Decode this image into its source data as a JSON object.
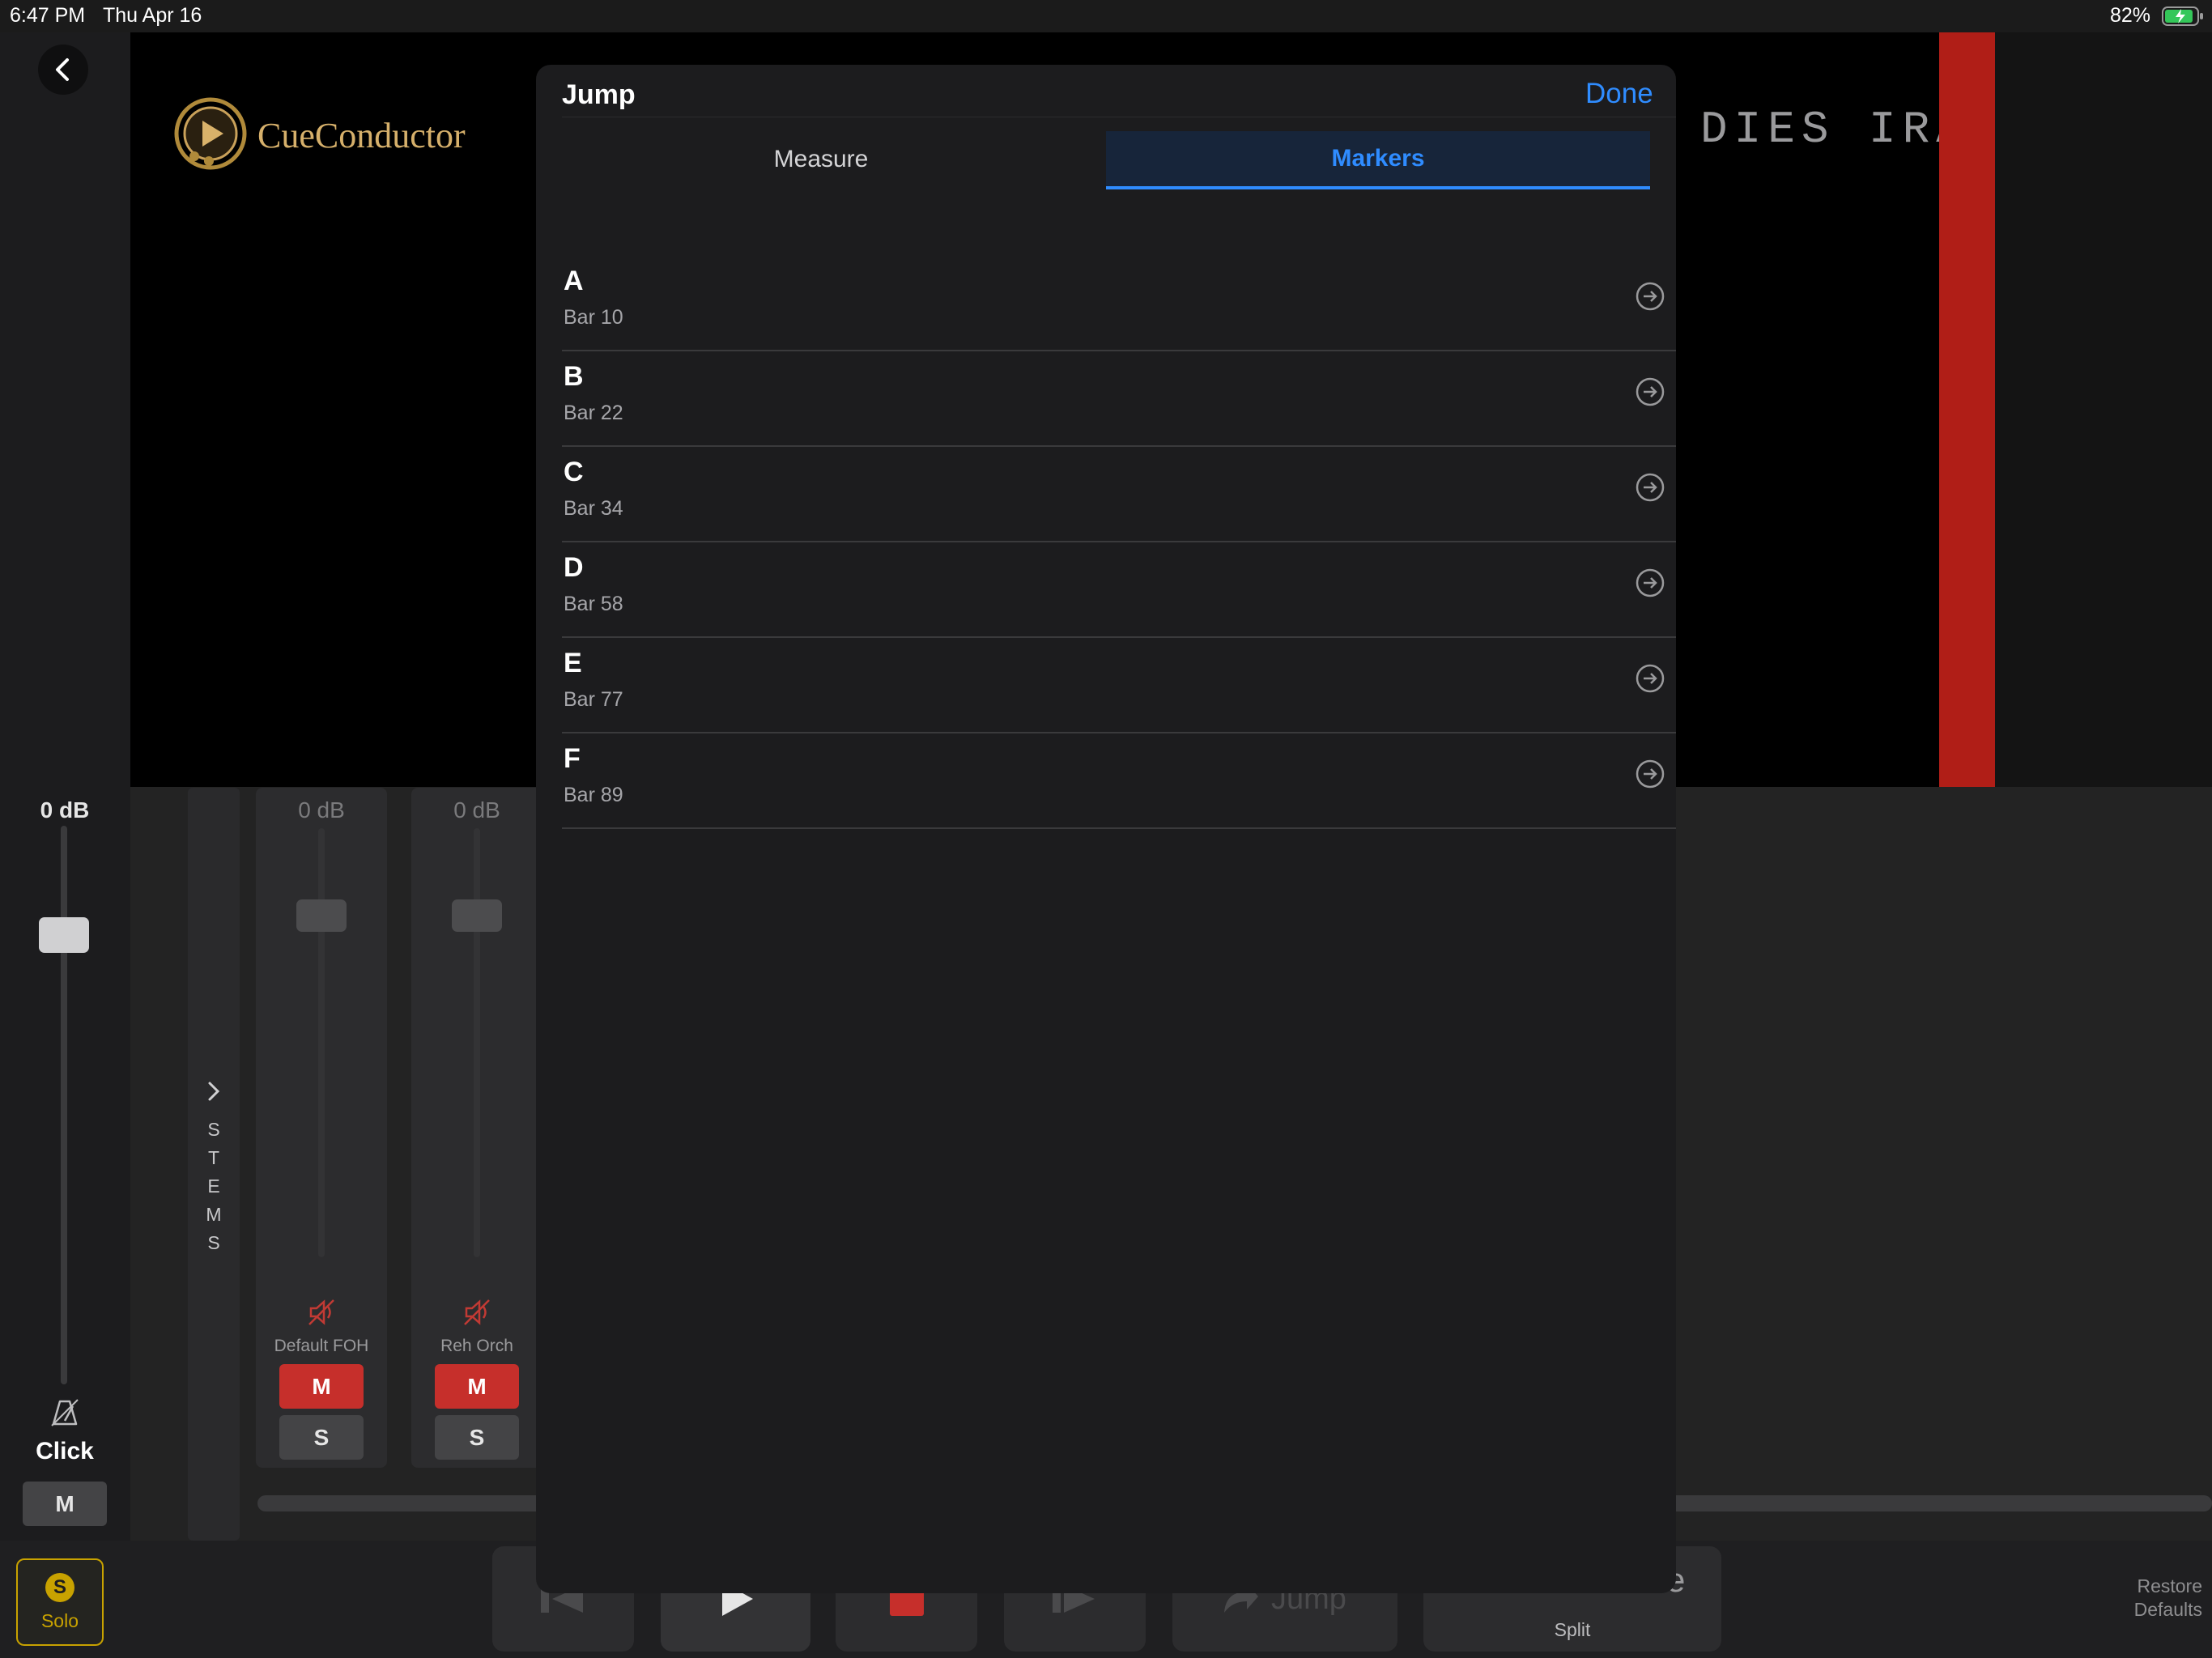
{
  "status_bar": {
    "time": "6:47 PM",
    "date": "Thu Apr 16",
    "battery": "82%"
  },
  "brand": {
    "name": "CueConductor"
  },
  "video": {
    "title_text": "DIES IRAE"
  },
  "click": {
    "db": "0 dB",
    "label": "Click",
    "mute_label": "M"
  },
  "stems_tab": {
    "letters": [
      "S",
      "T",
      "E",
      "M",
      "S"
    ]
  },
  "channels": [
    {
      "db": "0 dB",
      "name": "Default FOH",
      "mute": "M",
      "solo": "S"
    },
    {
      "db": "0 dB",
      "name": "Reh Orch",
      "mute": "M",
      "solo": "S"
    }
  ],
  "toolbar": {
    "solo_badge": "S",
    "solo_label": "Solo",
    "jump_label": "Jump",
    "mode_label": "FOH Mode",
    "mode_sub": "Split",
    "restore_line1": "Restore",
    "restore_line2": "Defaults"
  },
  "modal": {
    "title": "Jump",
    "done": "Done",
    "tabs": [
      "Measure",
      "Markers"
    ],
    "selected_tab": "Markers",
    "markers": [
      {
        "name": "A",
        "bar": "Bar 10"
      },
      {
        "name": "B",
        "bar": "Bar 22"
      },
      {
        "name": "C",
        "bar": "Bar 34"
      },
      {
        "name": "D",
        "bar": "Bar 58"
      },
      {
        "name": "E",
        "bar": "Bar 77"
      },
      {
        "name": "F",
        "bar": "Bar 89"
      }
    ]
  },
  "colors": {
    "accent": "#2f8cff",
    "mute": "#c62f2b",
    "marker_red": "#b01e17",
    "solo_gold": "#c8a200"
  }
}
